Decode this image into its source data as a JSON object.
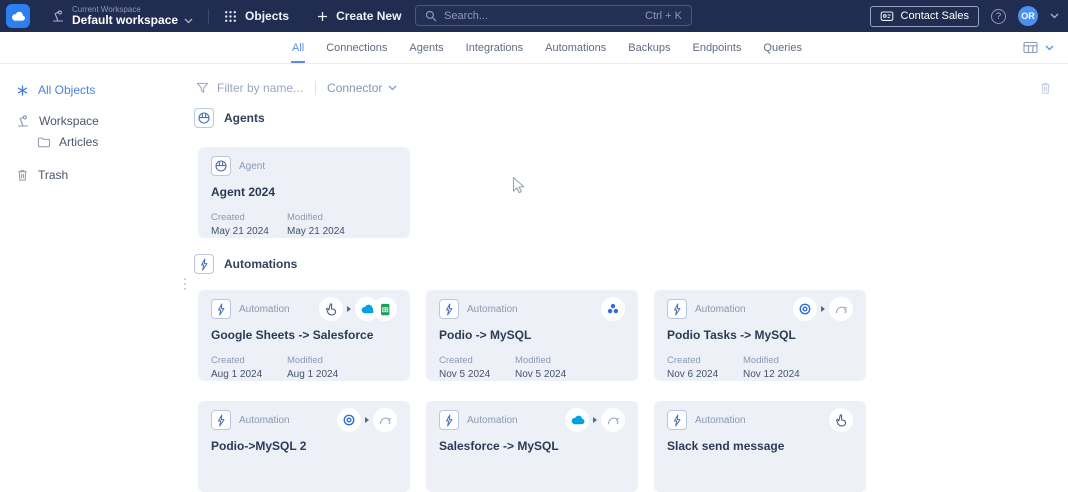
{
  "topbar": {
    "workspace_label": "Current Workspace",
    "workspace_name": "Default workspace",
    "objects_label": "Objects",
    "create_new_label": "Create New",
    "search_placeholder": "Search...",
    "search_shortcut": "Ctrl + K",
    "contact_sales_label": "Contact Sales",
    "help_glyph": "?",
    "avatar_initials": "OR",
    "icons": [
      "cloud-logo",
      "workspace-switch-icon",
      "chevron-down-icon",
      "apps-grid-icon",
      "plus-icon",
      "search-icon",
      "contact-sales-icon",
      "help-icon"
    ]
  },
  "tabs": {
    "items": [
      {
        "label": "All",
        "active": true
      },
      {
        "label": "Connections",
        "active": false
      },
      {
        "label": "Agents",
        "active": false
      },
      {
        "label": "Integrations",
        "active": false
      },
      {
        "label": "Automations",
        "active": false
      },
      {
        "label": "Backups",
        "active": false
      },
      {
        "label": "Endpoints",
        "active": false
      },
      {
        "label": "Queries",
        "active": false
      }
    ],
    "view_switcher_icons": [
      "table-view-icon",
      "chevron-down-icon"
    ]
  },
  "sidebar": {
    "items": [
      {
        "label": "All Objects",
        "icon": "asterisk-icon",
        "active": true
      },
      {
        "label": "Workspace",
        "icon": "workspace-lamp-icon",
        "active": false
      },
      {
        "label": "Articles",
        "icon": "folder-icon",
        "active": false
      },
      {
        "label": "Trash",
        "icon": "trash-icon",
        "active": false
      }
    ]
  },
  "filter": {
    "name_placeholder": "Filter by name...",
    "connector_label": "Connector",
    "icons": [
      "filter-funnel-icon",
      "chevron-down-icon",
      "trash-icon"
    ]
  },
  "agents_section": {
    "title": "Agents",
    "icon": "agent-icon",
    "cards": [
      {
        "type_label": "Agent",
        "title": "Agent 2024",
        "created_label": "Created",
        "created": "May 21 2024",
        "modified_label": "Modified",
        "modified": "May 21 2024",
        "icons": []
      }
    ]
  },
  "automations_section": {
    "title": "Automations",
    "icon": "bolt-icon",
    "cards": [
      {
        "type_label": "Automation",
        "title": "Google Sheets -> Salesforce",
        "created_label": "Created",
        "created": "Aug 1 2024",
        "modified_label": "Modified",
        "modified": "Aug 1 2024",
        "icons": [
          "manual-trigger-hand-icon",
          "play-arrow-icon",
          "salesforce-icon",
          "google-sheets-icon"
        ]
      },
      {
        "type_label": "Automation",
        "title": "Podio -> MySQL",
        "created_label": "Created",
        "created": "Nov 5 2024",
        "modified_label": "Modified",
        "modified": "Nov 5 2024",
        "icons": [
          "podio-icon"
        ]
      },
      {
        "type_label": "Automation",
        "title": "Podio Tasks -> MySQL",
        "created_label": "Created",
        "created": "Nov 6 2024",
        "modified_label": "Modified",
        "modified": "Nov 12 2024",
        "icons": [
          "podio-icon",
          "play-arrow-icon",
          "mysql-icon"
        ]
      },
      {
        "type_label": "Automation",
        "title": "Podio->MySQL 2",
        "icons": [
          "podio-icon",
          "play-arrow-icon",
          "mysql-icon"
        ]
      },
      {
        "type_label": "Automation",
        "title": "Salesforce -> MySQL",
        "icons": [
          "salesforce-icon",
          "play-arrow-icon",
          "mysql-icon"
        ]
      },
      {
        "type_label": "Automation",
        "title": "Slack send message",
        "icons": [
          "manual-trigger-hand-icon"
        ]
      }
    ]
  },
  "colors": {
    "topbar_bg": "#202c50",
    "logo_blue": "#2d7ff0",
    "avatar_blue": "#4a90f4",
    "accent_blue": "#4a80e8",
    "tab_active_blue": "#5b8def",
    "card_bg": "#edf1f7",
    "salesforce_blue": "#00a1e0",
    "sheets_green": "#1f9d58",
    "podio_blue": "#2e6ed9",
    "mysql_gray": "#93a3bb",
    "muted_text": "#8b99b3",
    "dark_text": "#2c3a57"
  }
}
